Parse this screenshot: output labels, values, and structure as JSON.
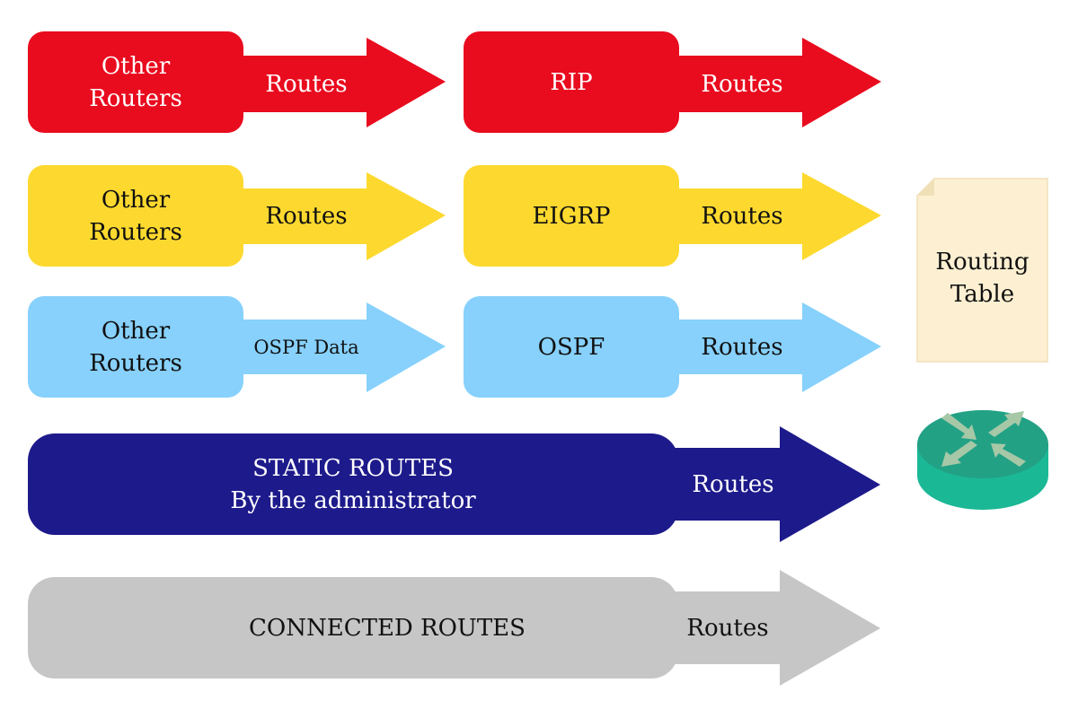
{
  "colors": {
    "rip": "#e90b1e",
    "eigrp": "#fdd92f",
    "ospf": "#87d1fc",
    "static": "#1d1a8b",
    "connected": "#c6c6c6",
    "routing_table_fill": "#fdf0d2",
    "routing_table_border": "#f0e0b8",
    "router_top": "#22a185",
    "router_side": "#1bb896",
    "router_arrows": "#a6c8a7",
    "text_light": "#ffffff",
    "text_dark": "#111111"
  },
  "rows": [
    {
      "id": "rip",
      "source": {
        "label": "Other\nRouters",
        "arrow_label": "Routes"
      },
      "protocol": {
        "label": "RIP",
        "arrow_label": "Routes"
      }
    },
    {
      "id": "eigrp",
      "source": {
        "label": "Other\nRouters",
        "arrow_label": "Routes"
      },
      "protocol": {
        "label": "EIGRP",
        "arrow_label": "Routes"
      }
    },
    {
      "id": "ospf",
      "source": {
        "label": "Other\nRouters",
        "arrow_label": "OSPF Data"
      },
      "protocol": {
        "label": "OSPF",
        "arrow_label": "Routes"
      }
    }
  ],
  "static": {
    "label": "STATIC ROUTES\nBy the administrator",
    "arrow_label": "Routes"
  },
  "connected": {
    "label": "CONNECTED ROUTES",
    "arrow_label": "Routes"
  },
  "routing_table": {
    "label": "Routing\nTable"
  },
  "router": {
    "icon": "router-icon"
  }
}
